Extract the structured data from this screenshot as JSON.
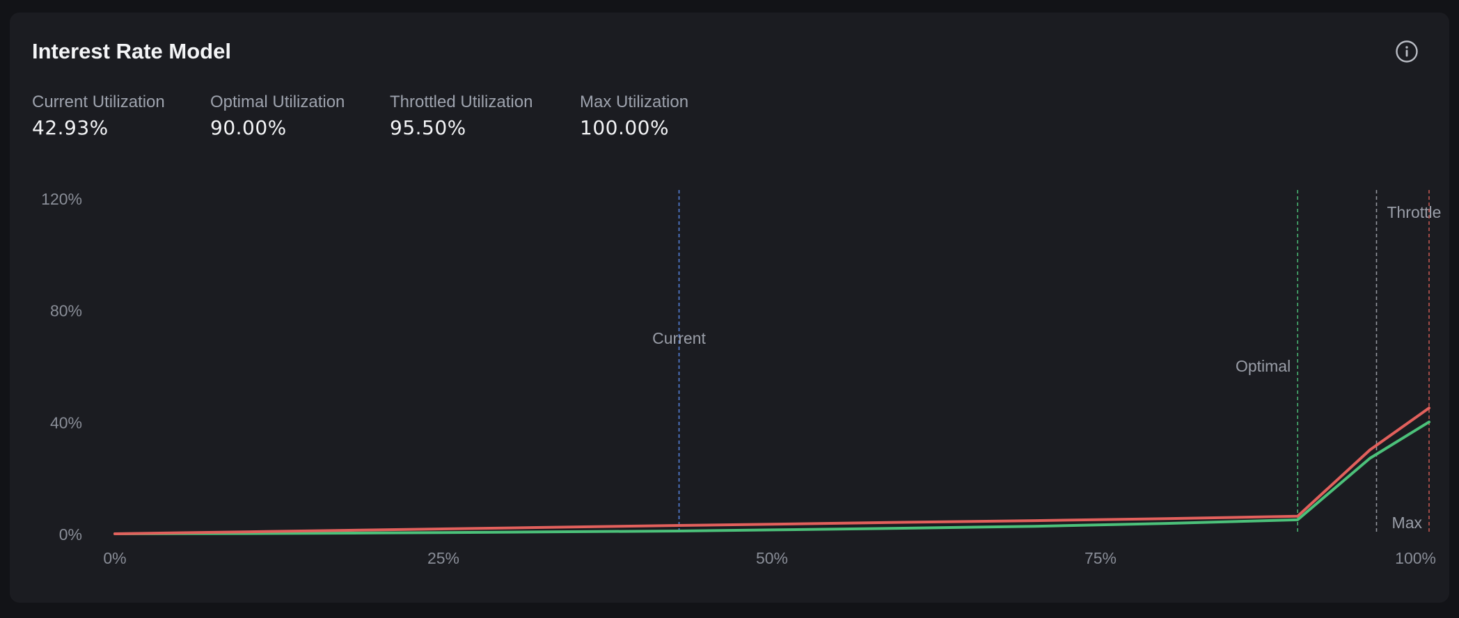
{
  "header": {
    "title": "Interest Rate Model"
  },
  "stats": [
    {
      "label": "Current Utilization",
      "value": "42.93%"
    },
    {
      "label": "Optimal Utilization",
      "value": "90.00%"
    },
    {
      "label": "Throttled Utilization",
      "value": "95.50%"
    },
    {
      "label": "Max Utilization",
      "value": "100.00%"
    }
  ],
  "icons": {
    "info": "info-circle-icon"
  },
  "colors": {
    "background": "#121317",
    "card": "#1b1c21",
    "series_red": "#e2605c",
    "series_green": "#4cc17a",
    "current_marker": "#5b8def",
    "optimal_marker": "#4cc17a",
    "throttle_marker": "#a0a3ab",
    "max_marker": "#d25c55",
    "tick_text": "#8a8e98"
  },
  "chart_data": {
    "type": "line",
    "xlabel": "",
    "ylabel": "",
    "xlim": [
      0,
      100
    ],
    "ylim": [
      0,
      120
    ],
    "x_ticks": [
      0,
      25,
      50,
      75,
      100
    ],
    "x_tick_labels": [
      "0%",
      "25%",
      "50%",
      "75%",
      "100%"
    ],
    "y_ticks": [
      0,
      40,
      80,
      120
    ],
    "y_tick_labels": [
      "0%",
      "40%",
      "80%",
      "120%"
    ],
    "grid": false,
    "legend": "none",
    "series": [
      {
        "x": [
          0,
          10,
          20,
          30,
          42.93,
          50,
          60,
          70,
          80,
          90,
          95.5,
          100
        ],
        "y": [
          0,
          0.7,
          1.4,
          2.1,
          3.0,
          3.4,
          4.1,
          4.7,
          5.4,
          6.3,
          30,
          45
        ]
      },
      {
        "x": [
          0,
          10,
          20,
          30,
          42.93,
          50,
          60,
          70,
          80,
          90,
          95.5,
          100
        ],
        "y": [
          0,
          0.1,
          0.3,
          0.6,
          1.0,
          1.4,
          2.0,
          2.7,
          3.7,
          5.0,
          27,
          40
        ]
      }
    ],
    "markers": [
      {
        "label": "Current",
        "x": 42.93,
        "label_y": 70
      },
      {
        "label": "Optimal",
        "x": 90,
        "label_y": 60
      },
      {
        "label": "Throttle",
        "x": 96,
        "label_y": 115
      },
      {
        "label": "Max",
        "x": 100,
        "label_y": 4
      }
    ]
  }
}
